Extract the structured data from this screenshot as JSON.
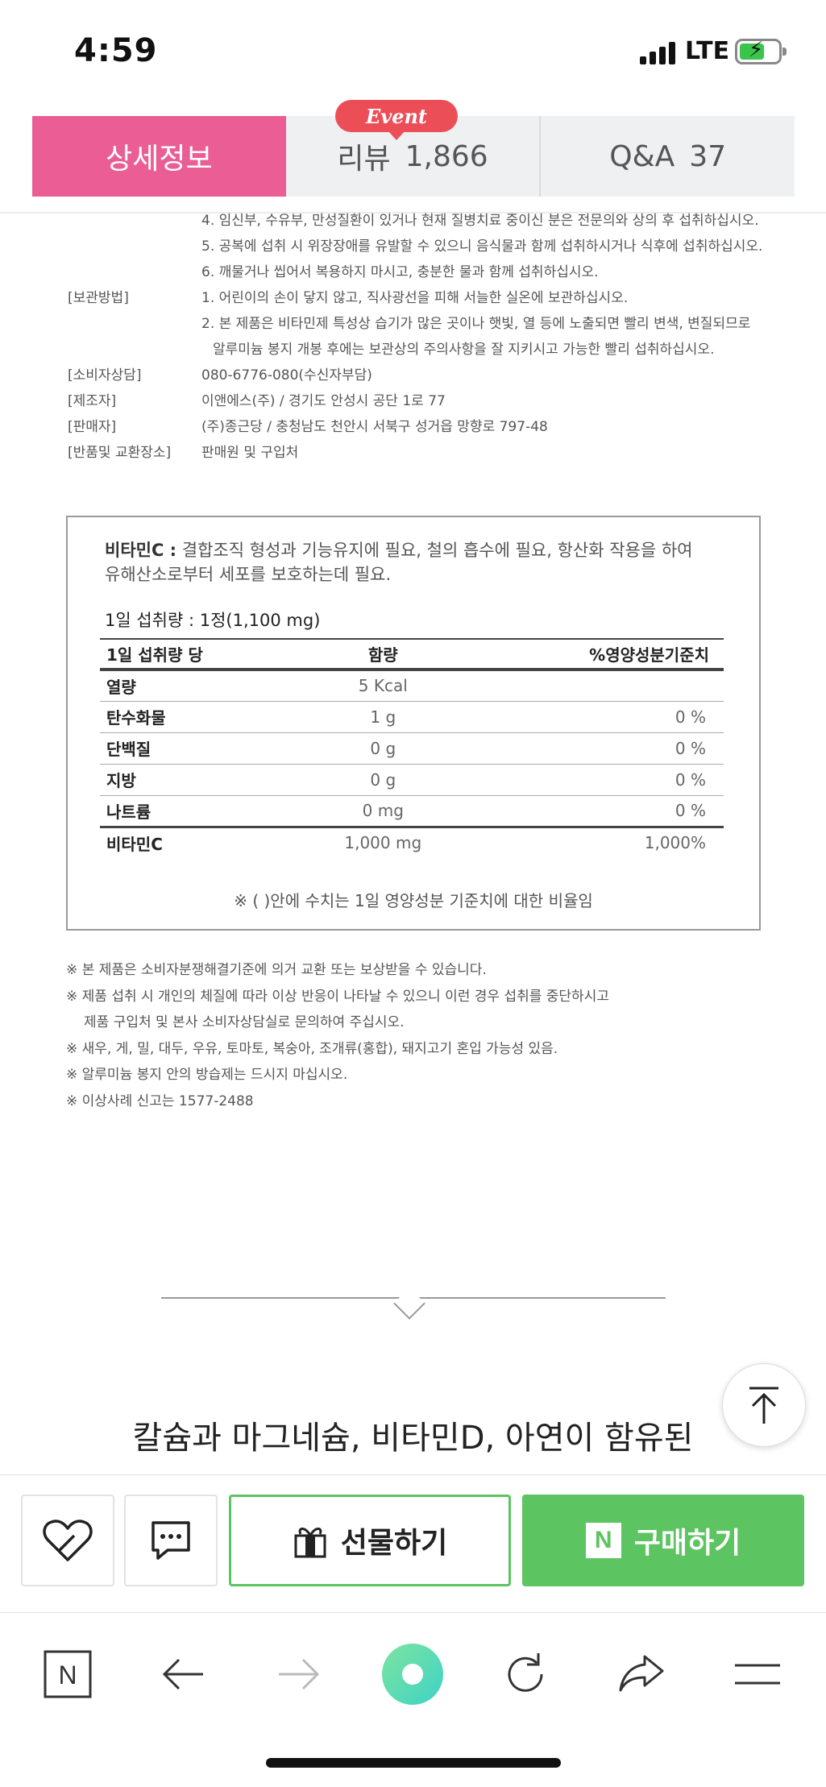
{
  "status_bar": {
    "time": "4:59",
    "network": "LTE"
  },
  "tabs": {
    "detail": "상세정보",
    "review_label": "리뷰",
    "review_count": "1,866",
    "qa_label": "Q&A",
    "qa_count": "37",
    "event_badge": "Event"
  },
  "info": {
    "cautions": [
      "4. 임신부, 수유부, 만성질환이 있거나 현재 질병치료 중이신 분은 전문의와 상의 후 섭취하십시오.",
      "5. 공복에 섭취 시 위장장애를 유발할 수 있으니 음식물과 함께 섭취하시거나 식후에 섭취하십시오.",
      "6. 깨물거나 씹어서 복용하지 마시고, 충분한 물과 함께 섭취하십시오."
    ],
    "storage_label": "[보관방법]",
    "storage_1": "1. 어린이의 손이 닿지 않고, 직사광선을 피해 서늘한 실온에 보관하십시오.",
    "storage_2a": "2. 본 제품은 비타민제 특성상 습기가 많은 곳이나 햇빛, 열 등에 노출되면 빨리 변색, 변질되므로",
    "storage_2b": "알루미늄 봉지 개봉 후에는 보관상의 주의사항을 잘 지키시고 가능한 빨리 섭취하십시오.",
    "consumer_label": "[소비자상담]",
    "consumer_value": "080-6776-080(수신자부담)",
    "maker_label": "[제조자]",
    "maker_value": "이앤에스(주) / 경기도 안성시 공단 1로 77",
    "seller_label": "[판매자]",
    "seller_value": "(주)종근당 / 충청남도 천안시 서북구 성거읍 망향로 797-48",
    "return_label": "[반품및 교환장소]",
    "return_value": "판매원 및 구입처"
  },
  "nutrition": {
    "vit_name": "비타민C :",
    "vit_desc_1": "결합조직 형성과 기능유지에 필요, 철의 흡수에 필요, 항산화 작용을 하여",
    "vit_desc_2": "유해산소로부터 세포를 보호하는데 필요.",
    "serving": "1일 섭취량 : 1정(1,100 mg)",
    "headers": [
      "1일 섭취량 당",
      "함량",
      "%영양성분기준치"
    ],
    "rows": [
      {
        "name": "열량",
        "amount": "5 Kcal",
        "percent": ""
      },
      {
        "name": "탄수화물",
        "amount": "1 g",
        "percent": "0 %"
      },
      {
        "name": "단백질",
        "amount": "0 g",
        "percent": "0 %"
      },
      {
        "name": "지방",
        "amount": "0 g",
        "percent": "0 %"
      },
      {
        "name": "나트륨",
        "amount": "0 mg",
        "percent": "0 %"
      },
      {
        "name": "비타민C",
        "amount": "1,000 mg",
        "percent": "1,000%"
      }
    ],
    "note": "※ ( )안에 수치는 1일 영양성분 기준치에 대한 비율임"
  },
  "notices": {
    "n1": "※ 본 제품은 소비자분쟁해결기준에 의거 교환 또는 보상받을 수 있습니다.",
    "n2a": "※ 제품 섭취 시 개인의 체질에 따라 이상 반응이 나타날 수 있으니 이런 경우 섭취를 중단하시고",
    "n2b": "제품 구입처 및 본사 소비자상담실로 문의하여 주십시오.",
    "n3": "※ 새우, 게, 밀, 대두, 우유, 토마토, 복숭아, 조개류(홍합), 돼지고기 혼입 가능성 있음.",
    "n4": "※ 알루미늄 봉지 안의 방습제는 드시지 마십시오.",
    "n5": "※ 이상사례 신고는 1577-2488"
  },
  "promo": {
    "heading": "칼슘과 마그네슘, 비타민D, 아연이 함유된"
  },
  "buy_bar": {
    "gift_label": "선물하기",
    "buy_label": "구매하기",
    "npay_mark": "N"
  },
  "browser": {
    "home_mark": "N"
  },
  "colors": {
    "tab_active": "#ea5e95",
    "event_badge": "#ec4e58",
    "buy_green": "#5cc460",
    "reload_gradient": [
      "#7ee3a0",
      "#3dd3c6"
    ]
  }
}
